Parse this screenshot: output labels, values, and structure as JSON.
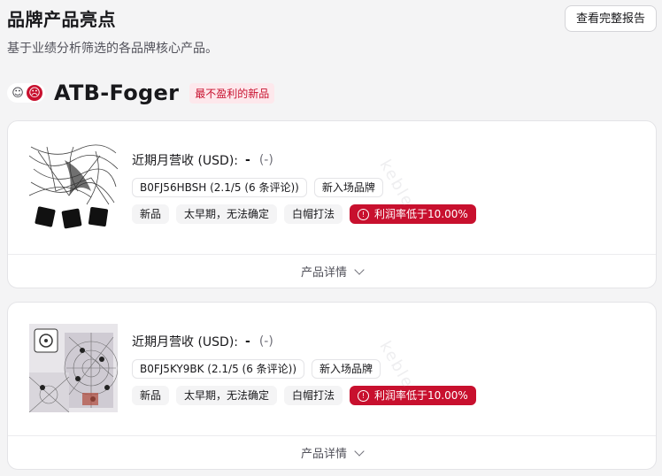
{
  "header": {
    "title": "品牌产品亮点",
    "subtitle": "基于业绩分析筛选的各品牌核心产品。",
    "report_button": "查看完整报告"
  },
  "brand": {
    "icons": [
      "neutral-face-icon",
      "sad-face-icon"
    ],
    "name": "ATB-Foger",
    "badge": "最不盈利的新品"
  },
  "products": [
    {
      "revenue_label": "近期月营收 (USD):",
      "revenue_value": "-",
      "revenue_change": "(-)",
      "asin_rating": "B0FJ56HBSH (2.1/5 (6 条评论))",
      "tags_row1": [
        "新入场品牌"
      ],
      "tags_row2": [
        "新品",
        "太早期，无法确定",
        "白帽打法"
      ],
      "alert": "利润率低于10.00%",
      "details": "产品详情"
    },
    {
      "revenue_label": "近期月营收 (USD):",
      "revenue_value": "-",
      "revenue_change": "(-)",
      "asin_rating": "B0FJ5KY9BK (2.1/5 (6 条评论))",
      "tags_row1": [
        "新入场品牌"
      ],
      "tags_row2": [
        "新品",
        "太早期，无法确定",
        "白帽打法"
      ],
      "alert": "利润率低于10.00%",
      "details": "产品详情"
    }
  ],
  "watermark": "keble",
  "colors": {
    "accent": "#c8102e",
    "accent_light": "#fde8ec",
    "background": "#f4f4f5"
  }
}
